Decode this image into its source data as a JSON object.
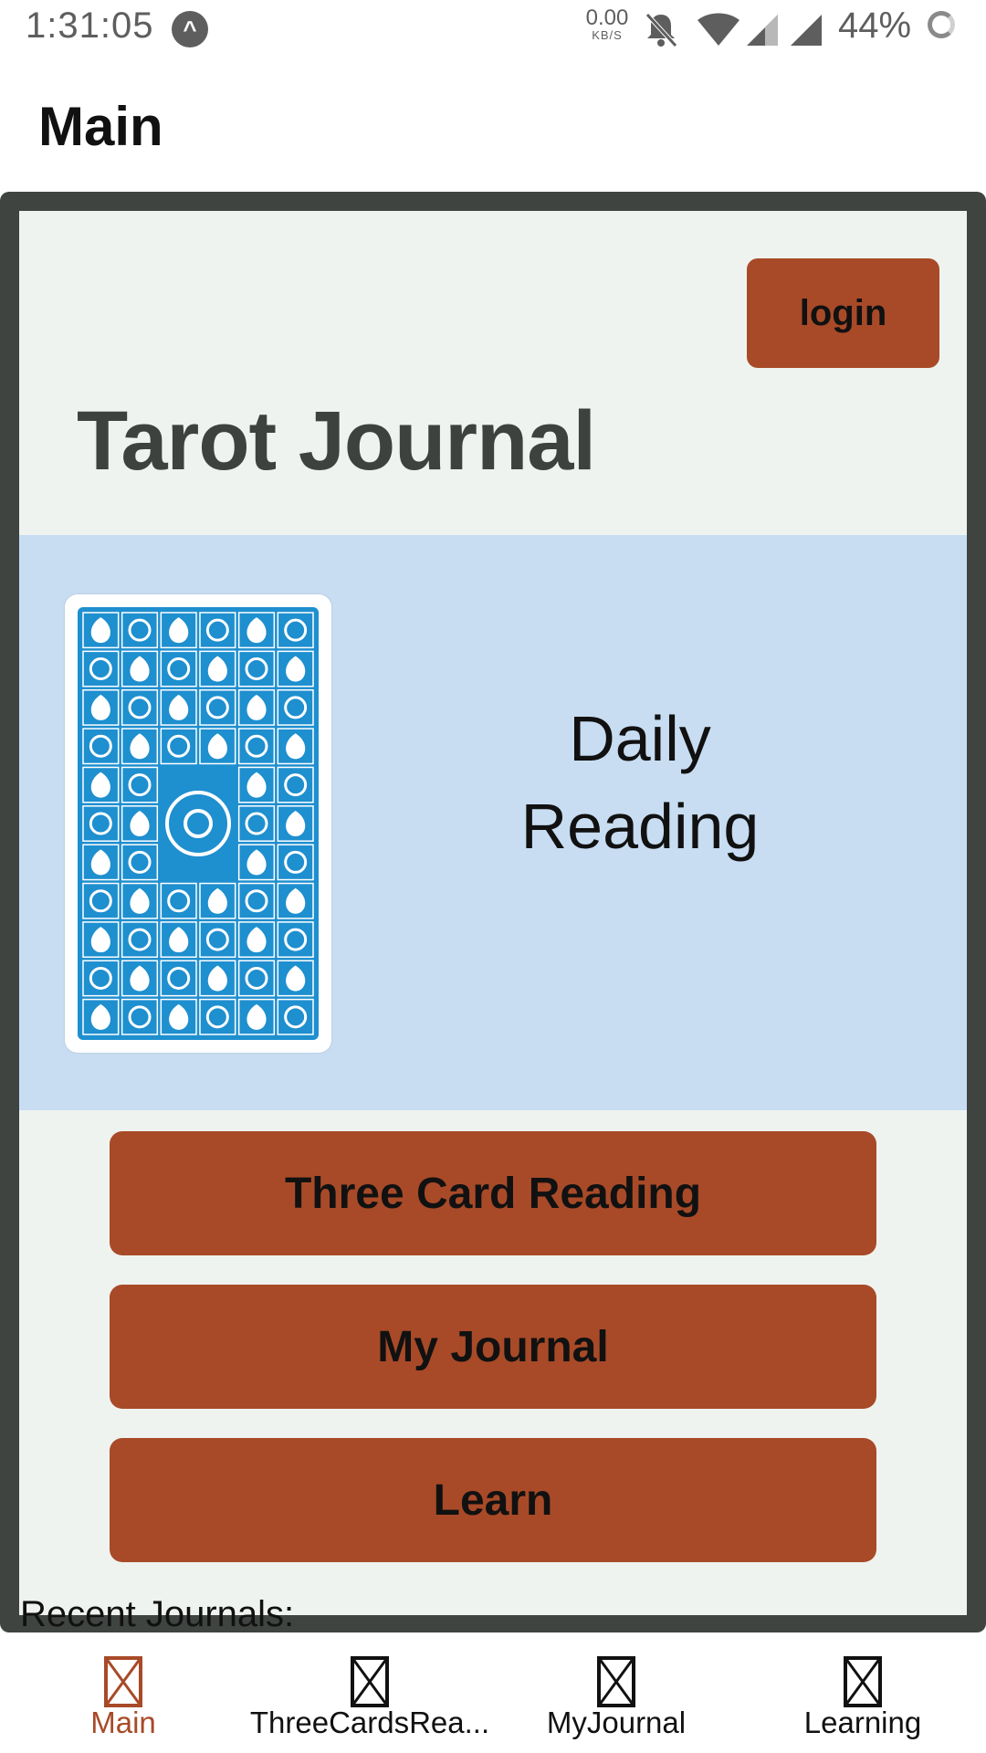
{
  "status_bar": {
    "time": "1:31:05",
    "net_speed_value": "0.00",
    "net_speed_unit": "KB/S",
    "battery": "44%",
    "icons": [
      "app-notification-icon",
      "bell-off-icon",
      "wifi-icon",
      "signal-icon",
      "signal-icon",
      "battery-icon"
    ]
  },
  "header": {
    "title": "Main"
  },
  "main": {
    "login_label": "login",
    "app_title": "Tarot Journal",
    "daily_reading": {
      "line1": "Daily",
      "line2": "Reading",
      "card_icon": "tarot-card-back"
    },
    "buttons": [
      {
        "label": "Three Card Reading"
      },
      {
        "label": "My Journal"
      },
      {
        "label": "Learn"
      }
    ],
    "recent_label": "Recent Journals:"
  },
  "tabs": [
    {
      "label": "Main",
      "active": true
    },
    {
      "label": "ThreeCardsRea...",
      "active": false
    },
    {
      "label": "MyJournal",
      "active": false
    },
    {
      "label": "Learning",
      "active": false
    }
  ],
  "colors": {
    "accent": "#a84a28",
    "frame": "#3f4441",
    "panel": "#c8ddf2",
    "background": "#eff3ef",
    "card_pattern": "#1e8fcf"
  }
}
